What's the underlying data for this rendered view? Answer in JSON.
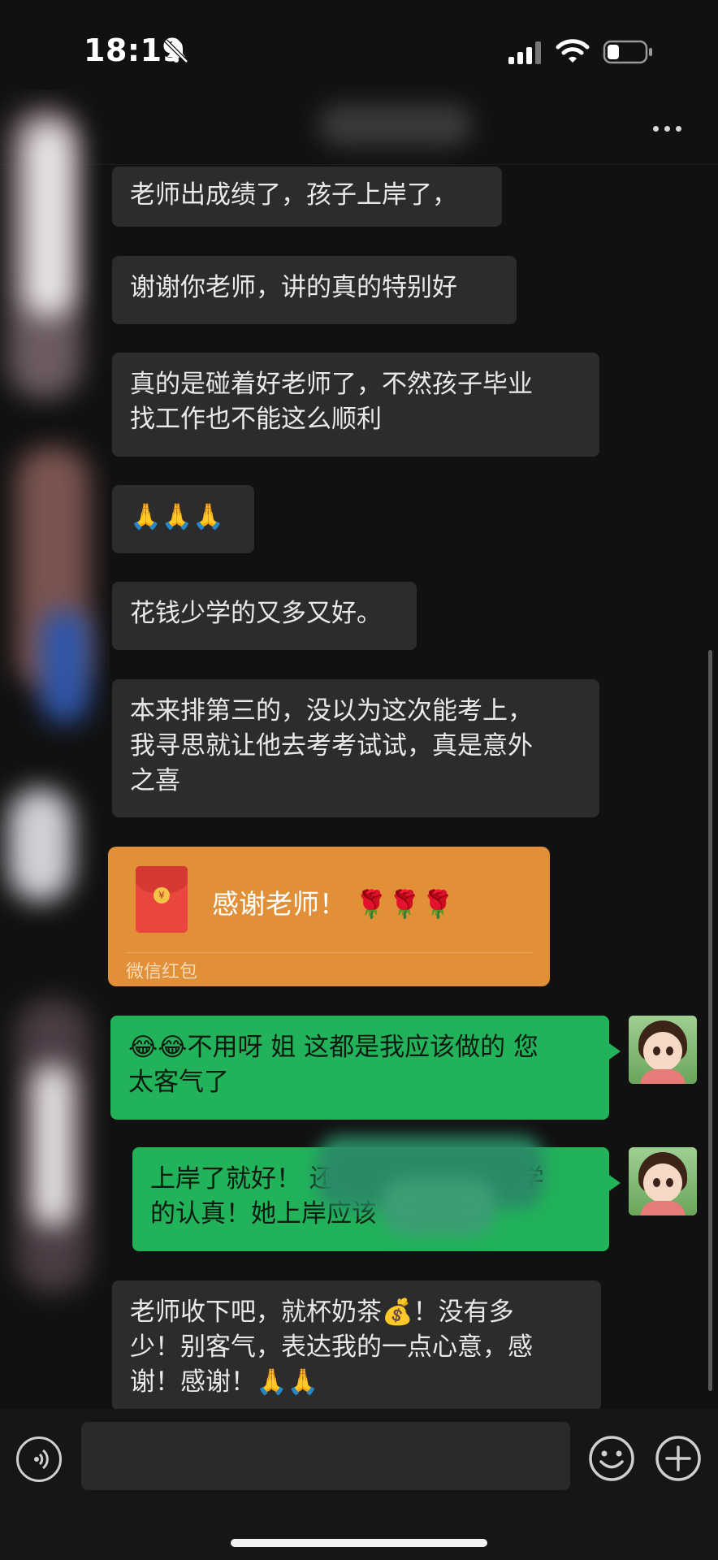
{
  "status_bar": {
    "time": "18:19",
    "icons": [
      "bell-off-icon",
      "signal-icon",
      "wifi-icon",
      "battery-icon"
    ]
  },
  "header": {
    "more_icon": "more-dots-icon"
  },
  "messages": [
    {
      "text": "老师出成绩了，孩子上岸了，"
    },
    {
      "text": "谢谢你老师，讲的真的特别好"
    },
    {
      "text": "真的是碰着好老师了，不然孩子毕业\n找工作也不能这么顺利"
    },
    {
      "text": "🙏🙏🙏"
    },
    {
      "text": "花钱少学的又多又好。"
    },
    {
      "text": "本来排第三的，没以为这次能考上，\n我寻思就让他去考考试试，真是意外\n之喜"
    },
    {
      "text": "😂😂不用呀 姐 这都是我应该做的 您\n太客气了"
    },
    {
      "text": "上岸了就好！ 还　　　自己努力 学\n的认真！她上岸应该　　！"
    },
    {
      "text": "老师收下吧，就杯奶茶💰！没有多\n少！别客气，表达我的一点心意，感\n谢！感谢！🙏🙏"
    }
  ],
  "red_packet": {
    "title": "感谢老师！ 🌹🌹🌹",
    "footer": "微信红包",
    "seal": "¥"
  },
  "input_bar": {
    "placeholder": ""
  },
  "colors": {
    "background": "#111111",
    "received_bubble": "#2c2c2c",
    "sent_bubble": "#21b25a",
    "red_packet": "#e29037"
  }
}
